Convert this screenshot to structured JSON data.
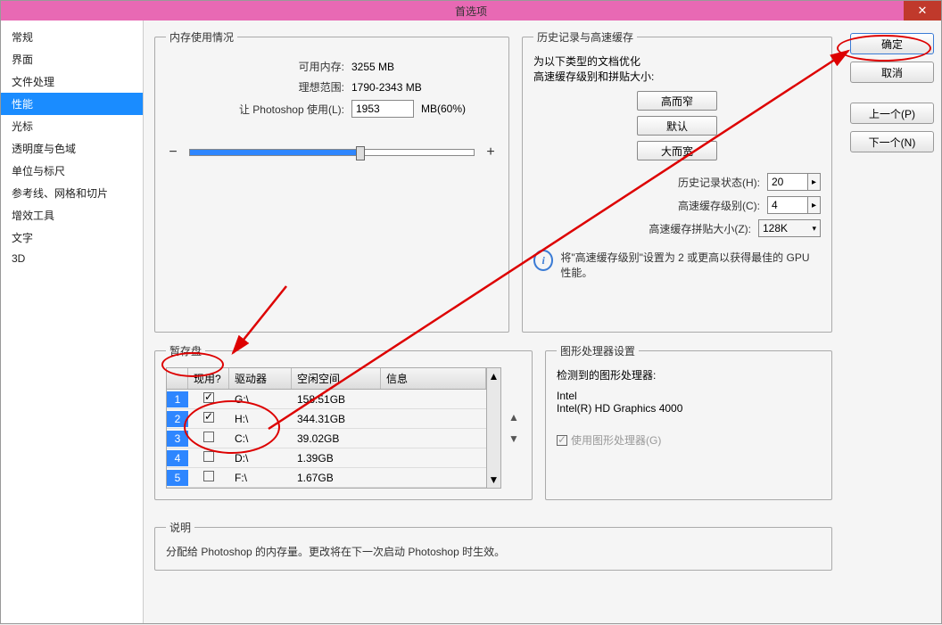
{
  "title": "首选项",
  "close_label": "✕",
  "sidebar": {
    "items": [
      {
        "label": "常规"
      },
      {
        "label": "界面"
      },
      {
        "label": "文件处理"
      },
      {
        "label": "性能"
      },
      {
        "label": "光标"
      },
      {
        "label": "透明度与色域"
      },
      {
        "label": "单位与标尺"
      },
      {
        "label": "参考线、网格和切片"
      },
      {
        "label": "增效工具"
      },
      {
        "label": "文字"
      },
      {
        "label": "3D"
      }
    ],
    "selected_index": 3
  },
  "buttons": {
    "ok": "确定",
    "cancel": "取消",
    "prev": "上一个(P)",
    "next": "下一个(N)"
  },
  "memory": {
    "legend": "内存使用情况",
    "available_label": "可用内存:",
    "available_value": "3255 MB",
    "ideal_label": "理想范围:",
    "ideal_value": "1790-2343 MB",
    "let_label": "让 Photoshop 使用(L):",
    "let_value": "1953",
    "let_unit": "MB(60%)",
    "minus": "−",
    "plus": "+"
  },
  "history": {
    "legend": "历史记录与高速缓存",
    "intro1": "为以下类型的文档优化",
    "intro2": "高速缓存级别和拼贴大小:",
    "btn_tall": "高而窄",
    "btn_default": "默认",
    "btn_wide": "大而宽",
    "states_label": "历史记录状态(H):",
    "states_value": "20",
    "cache_label": "高速缓存级别(C):",
    "cache_value": "4",
    "tile_label": "高速缓存拼贴大小(Z):",
    "tile_value": "128K",
    "info_text": "将\"高速缓存级别\"设置为 2 或更高以获得最佳的 GPU 性能。"
  },
  "scratch": {
    "legend": "暂存盘",
    "cols": {
      "num": "",
      "active": "现用?",
      "drive": "驱动器",
      "free": "空闲空间",
      "info": "信息"
    },
    "rows": [
      {
        "n": "1",
        "on": true,
        "drive": "G:\\",
        "free": "158.51GB",
        "info": ""
      },
      {
        "n": "2",
        "on": true,
        "drive": "H:\\",
        "free": "344.31GB",
        "info": ""
      },
      {
        "n": "3",
        "on": false,
        "drive": "C:\\",
        "free": "39.02GB",
        "info": ""
      },
      {
        "n": "4",
        "on": false,
        "drive": "D:\\",
        "free": "1.39GB",
        "info": ""
      },
      {
        "n": "5",
        "on": false,
        "drive": "F:\\",
        "free": "1.67GB",
        "info": ""
      }
    ]
  },
  "gpu": {
    "legend": "图形处理器设置",
    "detected_label": "检测到的图形处理器:",
    "vendor": "Intel",
    "model": "Intel(R) HD Graphics 4000",
    "use_label": "使用图形处理器(G)"
  },
  "desc": {
    "legend": "说明",
    "text": "分配给 Photoshop 的内存量。更改将在下一次启动 Photoshop 时生效。"
  }
}
